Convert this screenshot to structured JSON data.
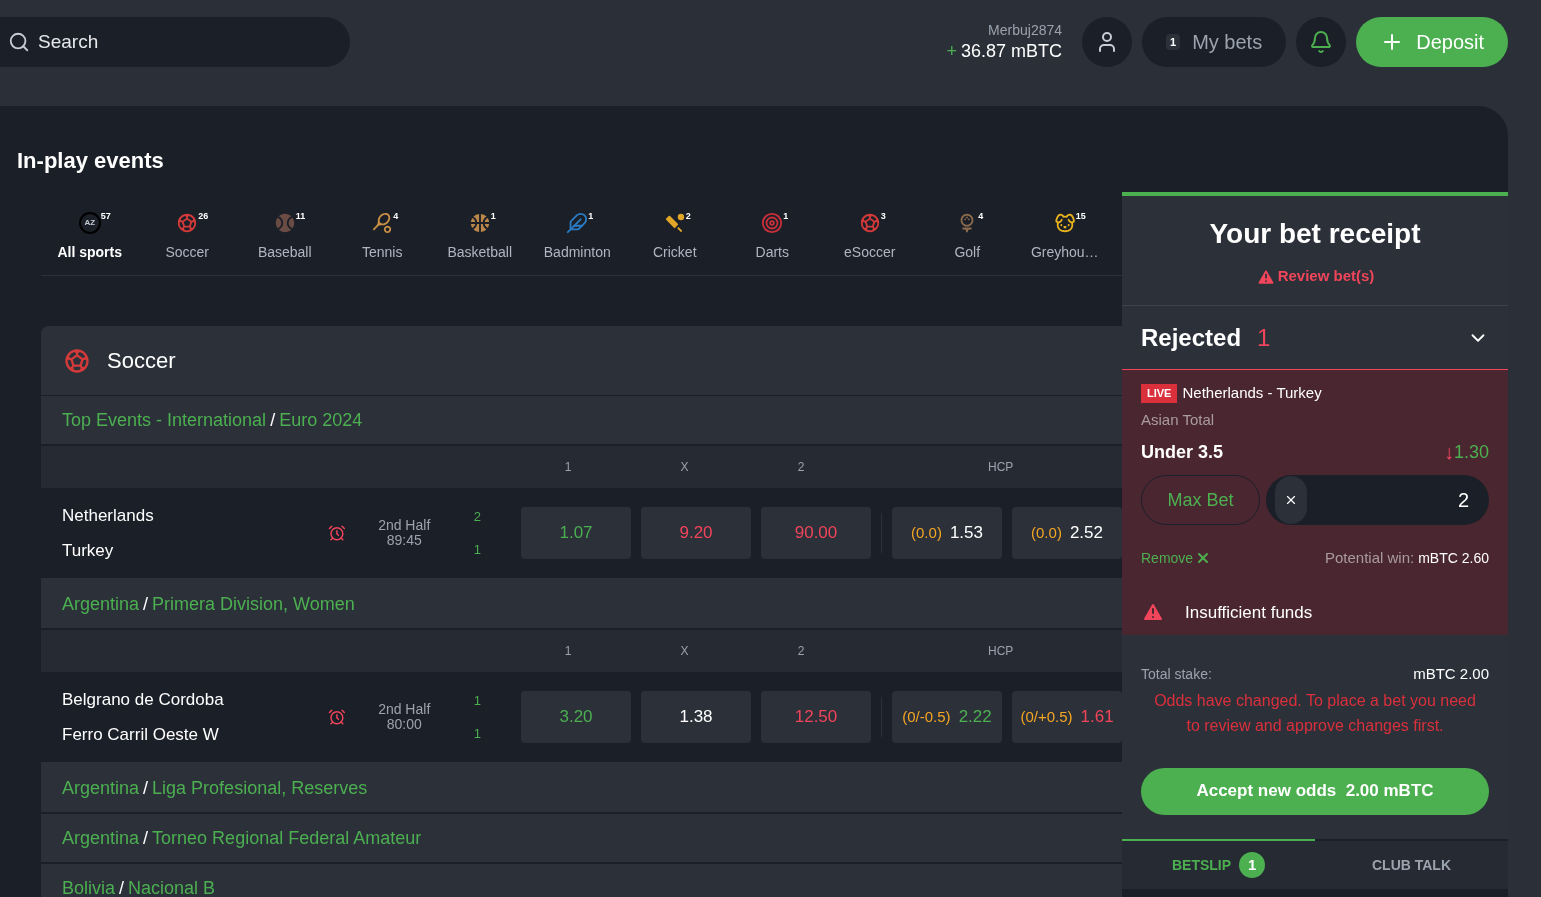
{
  "header": {
    "search_placeholder": "Search",
    "username": "Merbuj2874",
    "balance_sign": "+",
    "balance": "36.87 mBTC",
    "my_bets_count": "1",
    "my_bets": "My bets",
    "deposit": "Deposit"
  },
  "title": "In-play events",
  "sports": [
    {
      "kind": "all",
      "label": "All sports",
      "count": "57",
      "icon_text": "AZ",
      "color": "#000000",
      "selected": true
    },
    {
      "kind": "soccer",
      "label": "Soccer",
      "count": "26",
      "color": "#d43a3a",
      "selected": false
    },
    {
      "kind": "baseball",
      "label": "Baseball",
      "count": "11",
      "color": "#6b4c44",
      "selected": false
    },
    {
      "kind": "tennis",
      "label": "Tennis",
      "count": "4",
      "color": "#c98f45",
      "selected": false
    },
    {
      "kind": "basketball",
      "label": "Basketball",
      "count": "1",
      "color": "#b9874a",
      "selected": false
    },
    {
      "kind": "badminton",
      "label": "Badminton",
      "count": "1",
      "color": "#2a7bc4",
      "selected": false
    },
    {
      "kind": "cricket",
      "label": "Cricket",
      "count": "2",
      "color": "#e0a628",
      "selected": false
    },
    {
      "kind": "darts",
      "label": "Darts",
      "count": "1",
      "color": "#c7303a",
      "selected": false
    },
    {
      "kind": "esoccer",
      "label": "eSoccer",
      "count": "3",
      "color": "#d43a3a",
      "selected": false
    },
    {
      "kind": "golf",
      "label": "Golf",
      "count": "4",
      "color": "#8a6a4d",
      "selected": false
    },
    {
      "kind": "greyhound",
      "label": "Greyhou…",
      "count": "15",
      "color": "#e8b21e",
      "selected": false
    }
  ],
  "section": {
    "title": "Soccer",
    "leagues": [
      {
        "country": "Top Events - International",
        "separator": "/",
        "name": "Euro 2024",
        "columns": [
          "1",
          "X",
          "2",
          "HCP"
        ],
        "matches": [
          {
            "home": "Netherlands",
            "away": "Turkey",
            "period": "2nd Half",
            "clock": "89:45",
            "home_score": "2",
            "away_score": "1",
            "odds": [
              {
                "value": "1.07",
                "color": "#4caf50"
              },
              {
                "value": "9.20",
                "color": "#f0455a"
              },
              {
                "value": "90.00",
                "color": "#f0455a"
              }
            ],
            "hcp": [
              {
                "line": "(0.0)",
                "value": "1.53",
                "color": "#ffffff"
              },
              {
                "line": "(0.0)",
                "value": "2.52",
                "color": "#ffffff"
              }
            ]
          }
        ]
      },
      {
        "country": "Argentina",
        "separator": "/",
        "name": "Primera Division, Women",
        "columns": [
          "1",
          "X",
          "2",
          "HCP"
        ],
        "matches": [
          {
            "home": "Belgrano de Cordoba",
            "away": "Ferro Carril Oeste W",
            "period": "2nd Half",
            "clock": "80:00",
            "home_score": "1",
            "away_score": "1",
            "odds": [
              {
                "value": "3.20",
                "color": "#4caf50"
              },
              {
                "value": "1.38",
                "color": "#ffffff"
              },
              {
                "value": "12.50",
                "color": "#f0455a"
              }
            ],
            "hcp": [
              {
                "line": "(0/-0.5)",
                "value": "2.22",
                "color": "#4caf50"
              },
              {
                "line": "(0/+0.5)",
                "value": "1.61",
                "color": "#f0455a"
              }
            ]
          }
        ]
      },
      {
        "country": "Argentina",
        "separator": "/",
        "name": "Liga Profesional, Reserves"
      },
      {
        "country": "Argentina",
        "separator": "/",
        "name": "Torneo Regional Federal Amateur"
      },
      {
        "country": "Bolivia",
        "separator": "/",
        "name": "Nacional B"
      }
    ]
  },
  "receipt": {
    "title": "Your bet receipt",
    "review": "Review bet(s)",
    "status": "Rejected",
    "status_count": "1",
    "expanded": true,
    "bet": {
      "live": "LIVE",
      "event": "Netherlands - Turkey",
      "market": "Asian Total",
      "selection": "Under 3.5",
      "odds": "1.30",
      "odds_arrow": "↓",
      "max_bet": "Max Bet",
      "stake": "2",
      "remove": "Remove",
      "potential_label": "Potential win:",
      "potential_value": "mBTC 2.60",
      "error": "Insufficient funds"
    },
    "total_label": "Total stake:",
    "total_value": "mBTC 2.00",
    "message": "Odds have changed. To place a bet you need to review and approve changes first.",
    "accept": "Accept new odds  2.00 mBTC"
  },
  "bottom_tabs": [
    {
      "label": "BETSLIP",
      "badge": "1",
      "selected": true
    },
    {
      "label": "CLUB TALK",
      "selected": false
    }
  ]
}
